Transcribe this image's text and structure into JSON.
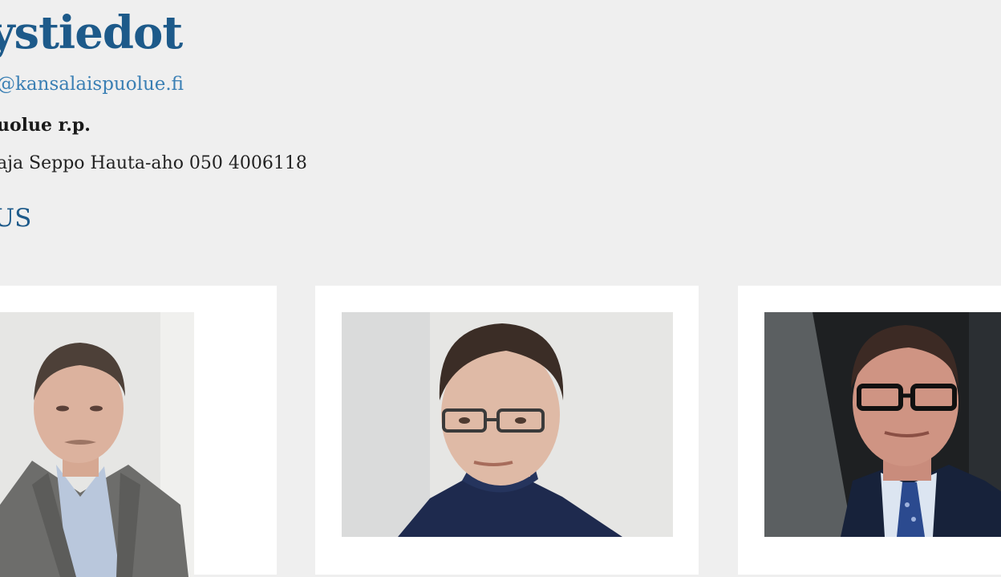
{
  "page": {
    "heading": "ystiedot",
    "email": "@kansalaispuolue.fi",
    "organization": "uolue r.p.",
    "contact": "aja Seppo Hauta-aho 050 4006118",
    "subheading": "US"
  },
  "colors": {
    "background": "#efefef",
    "heading": "#1d5a8a",
    "link": "#3a7fb4",
    "card": "#ffffff"
  }
}
